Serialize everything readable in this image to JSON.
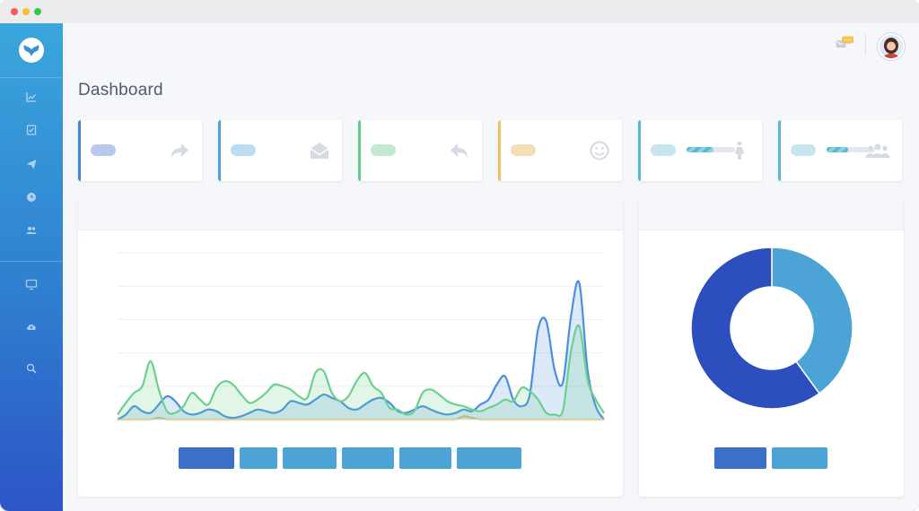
{
  "window": {
    "controls": [
      {
        "name": "close",
        "color": "#f25f58"
      },
      {
        "name": "minimize",
        "color": "#f9be2f"
      },
      {
        "name": "maximize",
        "color": "#35c84a"
      }
    ]
  },
  "sidebar": {
    "logo_icon": "whale-tail-logo-icon",
    "items": [
      {
        "icon": "line-chart-icon"
      },
      {
        "icon": "checklist-icon"
      },
      {
        "icon": "paper-plane-icon"
      },
      {
        "icon": "clock-icon"
      },
      {
        "icon": "users-icon"
      },
      {
        "icon": "monitor-icon"
      },
      {
        "icon": "cloud-upload-icon"
      },
      {
        "icon": "search-icon"
      }
    ]
  },
  "topbar": {
    "notification_icon": "mail-notification-icon",
    "avatar_icon": "user-avatar-icon"
  },
  "page": {
    "title": "Dashboard"
  },
  "stat_cards": [
    {
      "accent": "#3f86d6",
      "pill": "#b9c9ee",
      "icon": "share-arrow-icon"
    },
    {
      "accent": "#4ea5d8",
      "pill": "#bcdcf1",
      "icon": "envelope-open-icon"
    },
    {
      "accent": "#66cd8c",
      "pill": "#c2ead0",
      "icon": "reply-arrow-icon"
    },
    {
      "accent": "#f0c45a",
      "pill": "#f3dfb4",
      "icon": "smiley-icon"
    },
    {
      "accent": "#5bb6cf",
      "pill": "#c6e5ec",
      "icon": "female-icon",
      "progress": 0.55
    },
    {
      "accent": "#5bb6cf",
      "pill": "#c6e5ec",
      "icon": "users-group-icon",
      "progress": 0.45
    }
  ],
  "chart_data": [
    {
      "type": "area",
      "x": [
        0,
        1,
        2,
        3,
        4,
        5,
        6,
        7,
        8,
        9,
        10,
        11,
        12,
        13,
        14,
        15,
        16,
        17,
        18,
        19,
        20,
        21,
        22,
        23,
        24,
        25,
        26,
        27,
        28,
        29,
        30,
        31,
        32,
        33,
        34,
        35,
        36,
        37,
        38,
        39,
        40,
        41,
        42,
        43,
        44,
        45,
        46,
        47,
        48,
        49,
        50,
        51,
        52,
        53,
        54,
        55,
        56,
        57,
        58,
        59
      ],
      "series": [
        {
          "color": "#4a8fe0",
          "values": [
            0,
            0.3,
            0.8,
            0.5,
            0.4,
            0.9,
            1.4,
            1.1,
            0.5,
            0.3,
            0.4,
            0.6,
            0.5,
            0.2,
            0.1,
            0.2,
            0.4,
            0.6,
            0.5,
            0.4,
            0.6,
            1.1,
            1.0,
            0.9,
            1.2,
            1.5,
            1.3,
            1.1,
            0.7,
            0.6,
            0.9,
            1.2,
            1.3,
            1.0,
            0.5,
            0.4,
            0.6,
            0.8,
            0.6,
            0.4,
            0.3,
            0.4,
            0.6,
            0.5,
            0.9,
            1.2,
            2.1,
            2.6,
            1.2,
            0.8,
            1.5,
            5.4,
            5.9,
            3.0,
            2.2,
            6.2,
            8.2,
            3.0,
            0.8,
            0
          ]
        },
        {
          "color": "#6cd18e",
          "values": [
            0.3,
            1.0,
            1.6,
            2.0,
            3.5,
            1.8,
            0.5,
            0.4,
            0.8,
            1.6,
            1.2,
            0.9,
            1.9,
            2.3,
            2.1,
            1.5,
            1.0,
            1.2,
            1.6,
            2.1,
            2.0,
            1.8,
            1.4,
            1.3,
            2.8,
            2.9,
            1.6,
            1.1,
            1.4,
            2.3,
            2.8,
            2.0,
            1.6,
            0.7,
            0.6,
            0.3,
            0.5,
            1.6,
            1.8,
            1.5,
            1.1,
            0.9,
            0.8,
            0.6,
            0.5,
            0.7,
            0.9,
            1.2,
            1.1,
            1.9,
            1.7,
            1.2,
            0.4,
            0.3,
            0.5,
            4.1,
            5.6,
            2.4,
            1.2,
            0.4
          ]
        },
        {
          "color": "#f0c45a",
          "values": [
            0,
            0,
            0,
            0,
            0,
            0.1,
            0,
            0,
            0,
            0,
            0,
            0,
            0,
            0,
            0,
            0,
            0,
            0,
            0,
            0,
            0,
            0,
            0,
            0,
            0,
            0,
            0,
            0,
            0,
            0,
            0,
            0,
            0,
            0,
            0,
            0,
            0,
            0,
            0,
            0,
            0,
            0,
            0.2,
            0.1,
            0,
            0,
            0,
            0,
            0,
            0,
            0,
            0,
            0,
            0,
            0,
            0,
            0,
            0,
            0,
            0
          ]
        }
      ],
      "ylim": [
        0,
        10
      ],
      "grid": true,
      "legend_placement": "bottom-center",
      "legend": [
        {
          "color": "#3b70c8"
        },
        {
          "color": "#4ba3d6"
        },
        {
          "color": "#4ba3d6"
        },
        {
          "color": "#4ba3d6"
        },
        {
          "color": "#4ba3d6"
        },
        {
          "color": "#4ba3d6"
        }
      ]
    },
    {
      "type": "pie",
      "donut": true,
      "values": [
        60,
        40
      ],
      "colors": [
        "#2c4fbd",
        "#4ba3d6"
      ],
      "legend_placement": "bottom-center",
      "legend": [
        {
          "color": "#3b70c8"
        },
        {
          "color": "#4ba3d6"
        }
      ]
    }
  ]
}
